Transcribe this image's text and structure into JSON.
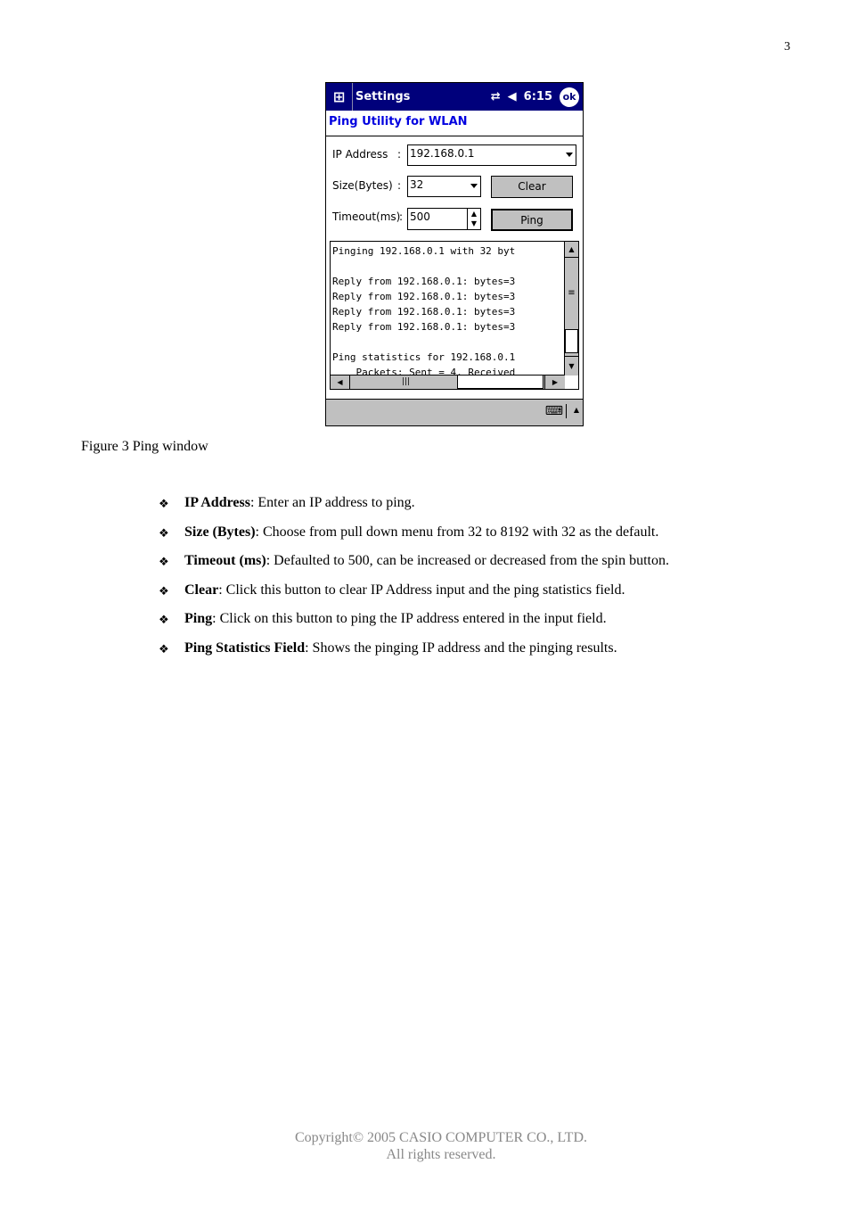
{
  "page_number": "3",
  "device": {
    "title": "Settings",
    "time": "6:15",
    "ok_label": "ok",
    "subtitle": "Ping Utility for WLAN",
    "ip_label": "IP Address",
    "size_label": "Size(Bytes)",
    "timeout_label": "Timeout(ms)",
    "colon": ":",
    "ip_value": "192.168.0.1",
    "size_value": "32",
    "timeout_value": "500",
    "clear_label": "Clear",
    "ping_label": "Ping",
    "output_lines": [
      "Pinging 192.168.0.1 with 32 byt",
      "",
      "Reply from 192.168.0.1: bytes=3",
      "Reply from 192.168.0.1: bytes=3",
      "Reply from 192.168.0.1: bytes=3",
      "Reply from 192.168.0.1: bytes=3",
      "",
      "Ping statistics for 192.168.0.1",
      "    Packets: Sent = 4, Received"
    ],
    "titlebar_color": "#00007b",
    "subtitle_color": "#0000e0"
  },
  "caption": "Figure 3 Ping window",
  "bullets": [
    {
      "term": "IP Address",
      "desc": ": Enter an IP address to ping."
    },
    {
      "term": "Size (Bytes)",
      "desc": ": Choose from pull down menu from 32 to 8192 with 32 as the default."
    },
    {
      "term": "Timeout (ms)",
      "desc": ": Defaulted to 500, can be increased or decreased from the spin button."
    },
    {
      "term": "Clear",
      "desc": ": Click this button to clear IP Address input and the ping statistics field."
    },
    {
      "term": "Ping",
      "desc": ": Click on this button to ping the IP address entered in the input field."
    },
    {
      "term": "Ping Statistics Field",
      "desc": ": Shows the pinging IP address and the pinging results."
    }
  ],
  "footer": {
    "line1": "Copyright© 2005 CASIO COMPUTER CO., LTD.",
    "line2": "All rights reserved."
  }
}
